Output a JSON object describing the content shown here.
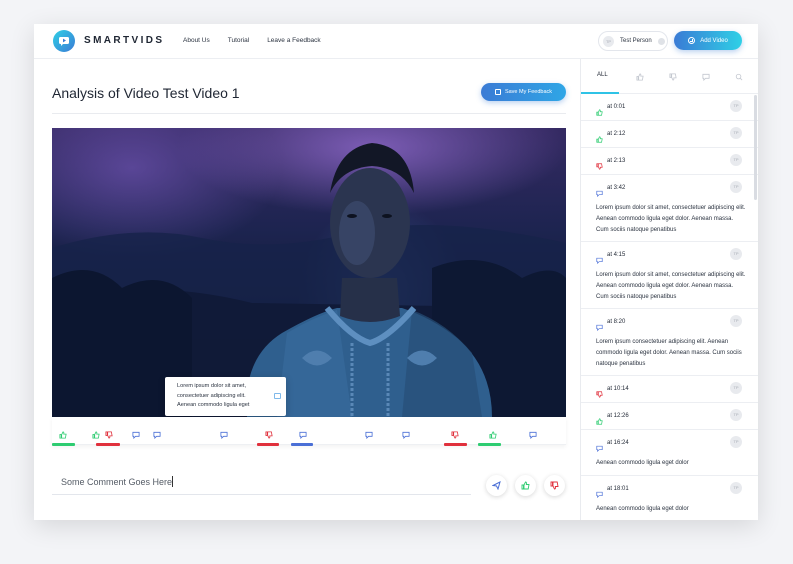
{
  "app": {
    "brand": "SMARTVIDS"
  },
  "nav": {
    "items": [
      "About Us",
      "Tutorial",
      "Leave a Feedback"
    ]
  },
  "user": {
    "initials": "TP",
    "name": "Test Person"
  },
  "actions": {
    "add_video": "Add Video",
    "save_feedback": "Save My Feedback"
  },
  "page": {
    "title": "Analysis of Video Test Video 1"
  },
  "tooltip": {
    "lines": [
      "Lorem ipsum dolor sit amet,",
      "consectetuer adipiscing elit.",
      "Aenean commodo ligula eget"
    ]
  },
  "comment": {
    "value": "Some Comment Goes Here"
  },
  "colors": {
    "accent": "#2fc3e6",
    "primary": "#3a7bd5",
    "like": "#2ecc71",
    "dislike": "#e0303c",
    "comment": "#4a6fd6"
  },
  "timeline": {
    "markers": [
      {
        "type": "like"
      },
      {
        "type": "like"
      },
      {
        "type": "dislike"
      },
      {
        "type": "comment"
      },
      {
        "type": "comment"
      },
      {
        "type": "comment"
      },
      {
        "type": "dislike"
      },
      {
        "type": "comment"
      },
      {
        "type": "comment"
      },
      {
        "type": "comment"
      },
      {
        "type": "dislike"
      },
      {
        "type": "like"
      },
      {
        "type": "comment"
      }
    ]
  },
  "sidebar": {
    "tabs": [
      {
        "label": "ALL",
        "icon": "list-icon"
      },
      {
        "label": "",
        "icon": "thumbs-up-icon"
      },
      {
        "label": "",
        "icon": "thumbs-down-icon"
      },
      {
        "label": "",
        "icon": "comment-icon"
      },
      {
        "label": "",
        "icon": "search-icon"
      }
    ],
    "items": [
      {
        "type": "like",
        "time": "at 0:01",
        "initials": "TP",
        "text": ""
      },
      {
        "type": "like",
        "time": "at 2:12",
        "initials": "TP",
        "text": ""
      },
      {
        "type": "dislike",
        "time": "at 2:13",
        "initials": "TP",
        "text": ""
      },
      {
        "type": "comment",
        "time": "at 3:42",
        "initials": "TP",
        "text": "Lorem ipsum dolor sit amet, consectetuer adipiscing elit. Aenean commodo ligula eget dolor. Aenean massa. Cum sociis natoque penatibus"
      },
      {
        "type": "comment",
        "time": "at 4:15",
        "initials": "TP",
        "text": "Lorem ipsum dolor sit amet, consectetuer adipiscing elit. Aenean commodo ligula eget dolor. Aenean massa. Cum sociis natoque penatibus"
      },
      {
        "type": "comment",
        "time": "at 8:20",
        "initials": "TP",
        "text": "Lorem ipsum consectetuer adipiscing elit. Aenean commodo ligula eget dolor. Aenean massa. Cum sociis natoque penatibus"
      },
      {
        "type": "dislike",
        "time": "at 10:14",
        "initials": "TP",
        "text": ""
      },
      {
        "type": "like",
        "time": "at 12:26",
        "initials": "TP",
        "text": ""
      },
      {
        "type": "comment",
        "time": "at 16:24",
        "initials": "TP",
        "text": "Aenean commodo ligula eget dolor"
      },
      {
        "type": "comment",
        "time": "at 18:01",
        "initials": "TP",
        "text": "Aenean commodo ligula eget dolor"
      }
    ]
  }
}
